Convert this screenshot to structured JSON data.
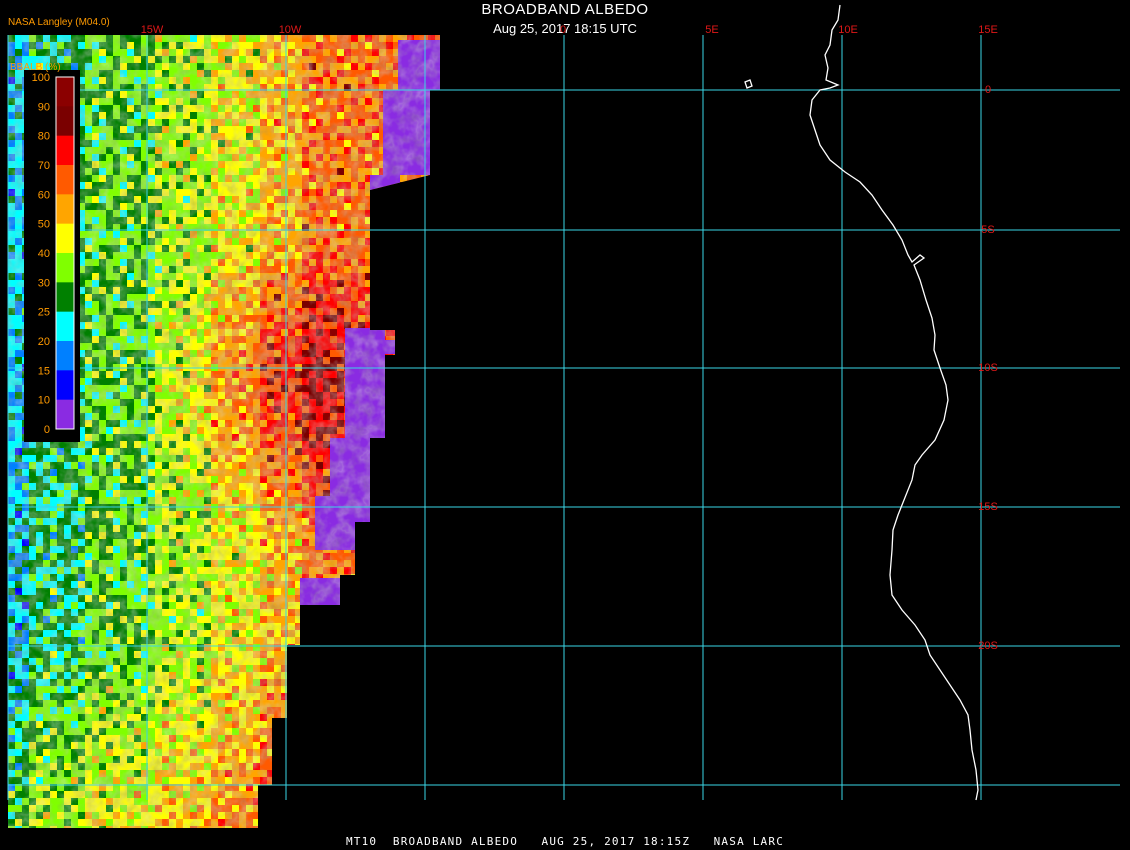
{
  "header": {
    "title": "BROADBAND ALBEDO",
    "subtitle": "Aug 25, 2017 18:15 UTC",
    "credit": "NASA Langley (M04.0)"
  },
  "footer": {
    "caption": "MT10  BROADBAND ALBEDO   AUG 25, 2017 18:15Z   NASA LARC"
  },
  "legend": {
    "title": "BBALB (%)",
    "ticks": [
      "100",
      "90",
      "80",
      "70",
      "60",
      "50",
      "40",
      "30",
      "25",
      "20",
      "15",
      "10",
      "0"
    ],
    "colors": [
      "#8b0000",
      "#7a0000",
      "#ff0000",
      "#ff5a00",
      "#ffa500",
      "#ffff00",
      "#80ff00",
      "#008000",
      "#00ffff",
      "#0080ff",
      "#0000ff",
      "#8a2be2"
    ]
  },
  "grid": {
    "longitude_labels": [
      "15W",
      "10W",
      "0",
      "5E",
      "10E",
      "15E"
    ],
    "latitude_labels": [
      "0",
      "5S",
      "10S",
      "15S",
      "20S"
    ]
  },
  "colors": {
    "grid": "#3ad6e6",
    "grid_label": "#e01818",
    "coastline": "#ffffff",
    "background": "#000000",
    "legend_text": "#ff9a00",
    "missing": "#8a2be2"
  }
}
